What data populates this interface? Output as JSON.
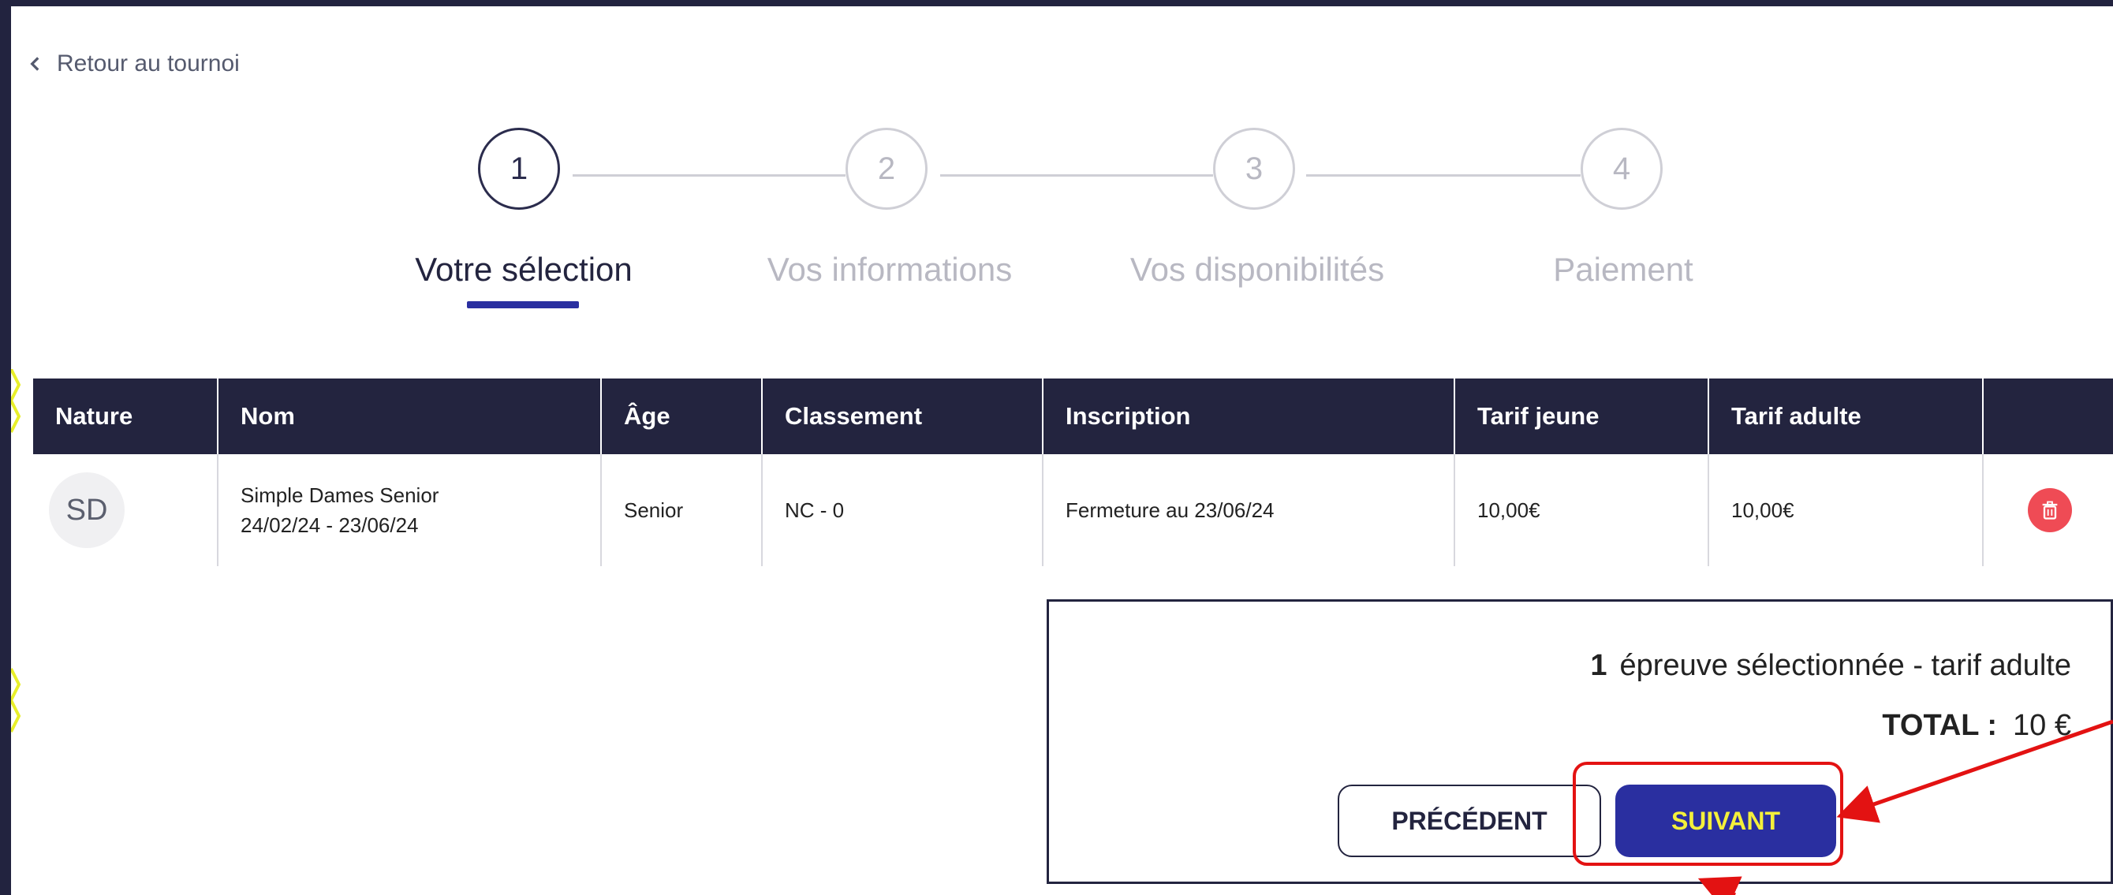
{
  "nav": {
    "back_label": "Retour au tournoi"
  },
  "stepper": {
    "steps": [
      {
        "number": "1",
        "label": "Votre sélection"
      },
      {
        "number": "2",
        "label": "Vos informations"
      },
      {
        "number": "3",
        "label": "Vos disponibilités"
      },
      {
        "number": "4",
        "label": "Paiement"
      }
    ],
    "active_step": 1
  },
  "table": {
    "headers": [
      "Nature",
      "Nom",
      "Âge",
      "Classement",
      "Inscription",
      "Tarif jeune",
      "Tarif adulte",
      ""
    ],
    "rows": [
      {
        "nature": "SD",
        "nom_line1": "Simple Dames Senior",
        "nom_line2": "24/02/24 - 23/06/24",
        "age": "Senior",
        "classement": "NC - 0",
        "inscription": "Fermeture au 23/06/24",
        "tarif_jeune": "10,00€",
        "tarif_adulte": "10,00€",
        "delete_icon": "trash-icon"
      }
    ]
  },
  "summary": {
    "count": "1",
    "count_text": "épreuve sélectionnée - tarif adulte",
    "total_label": "TOTAL :",
    "total_value": "10 €"
  },
  "buttons": {
    "previous": "PRÉCÉDENT",
    "next": "SUIVANT"
  },
  "colors": {
    "navy": "#23243f",
    "accent_blue": "#2a2fa0",
    "accent_yellow": "#f4f03a",
    "delete_red": "#ef4b55",
    "annotation_red": "#e31212"
  }
}
